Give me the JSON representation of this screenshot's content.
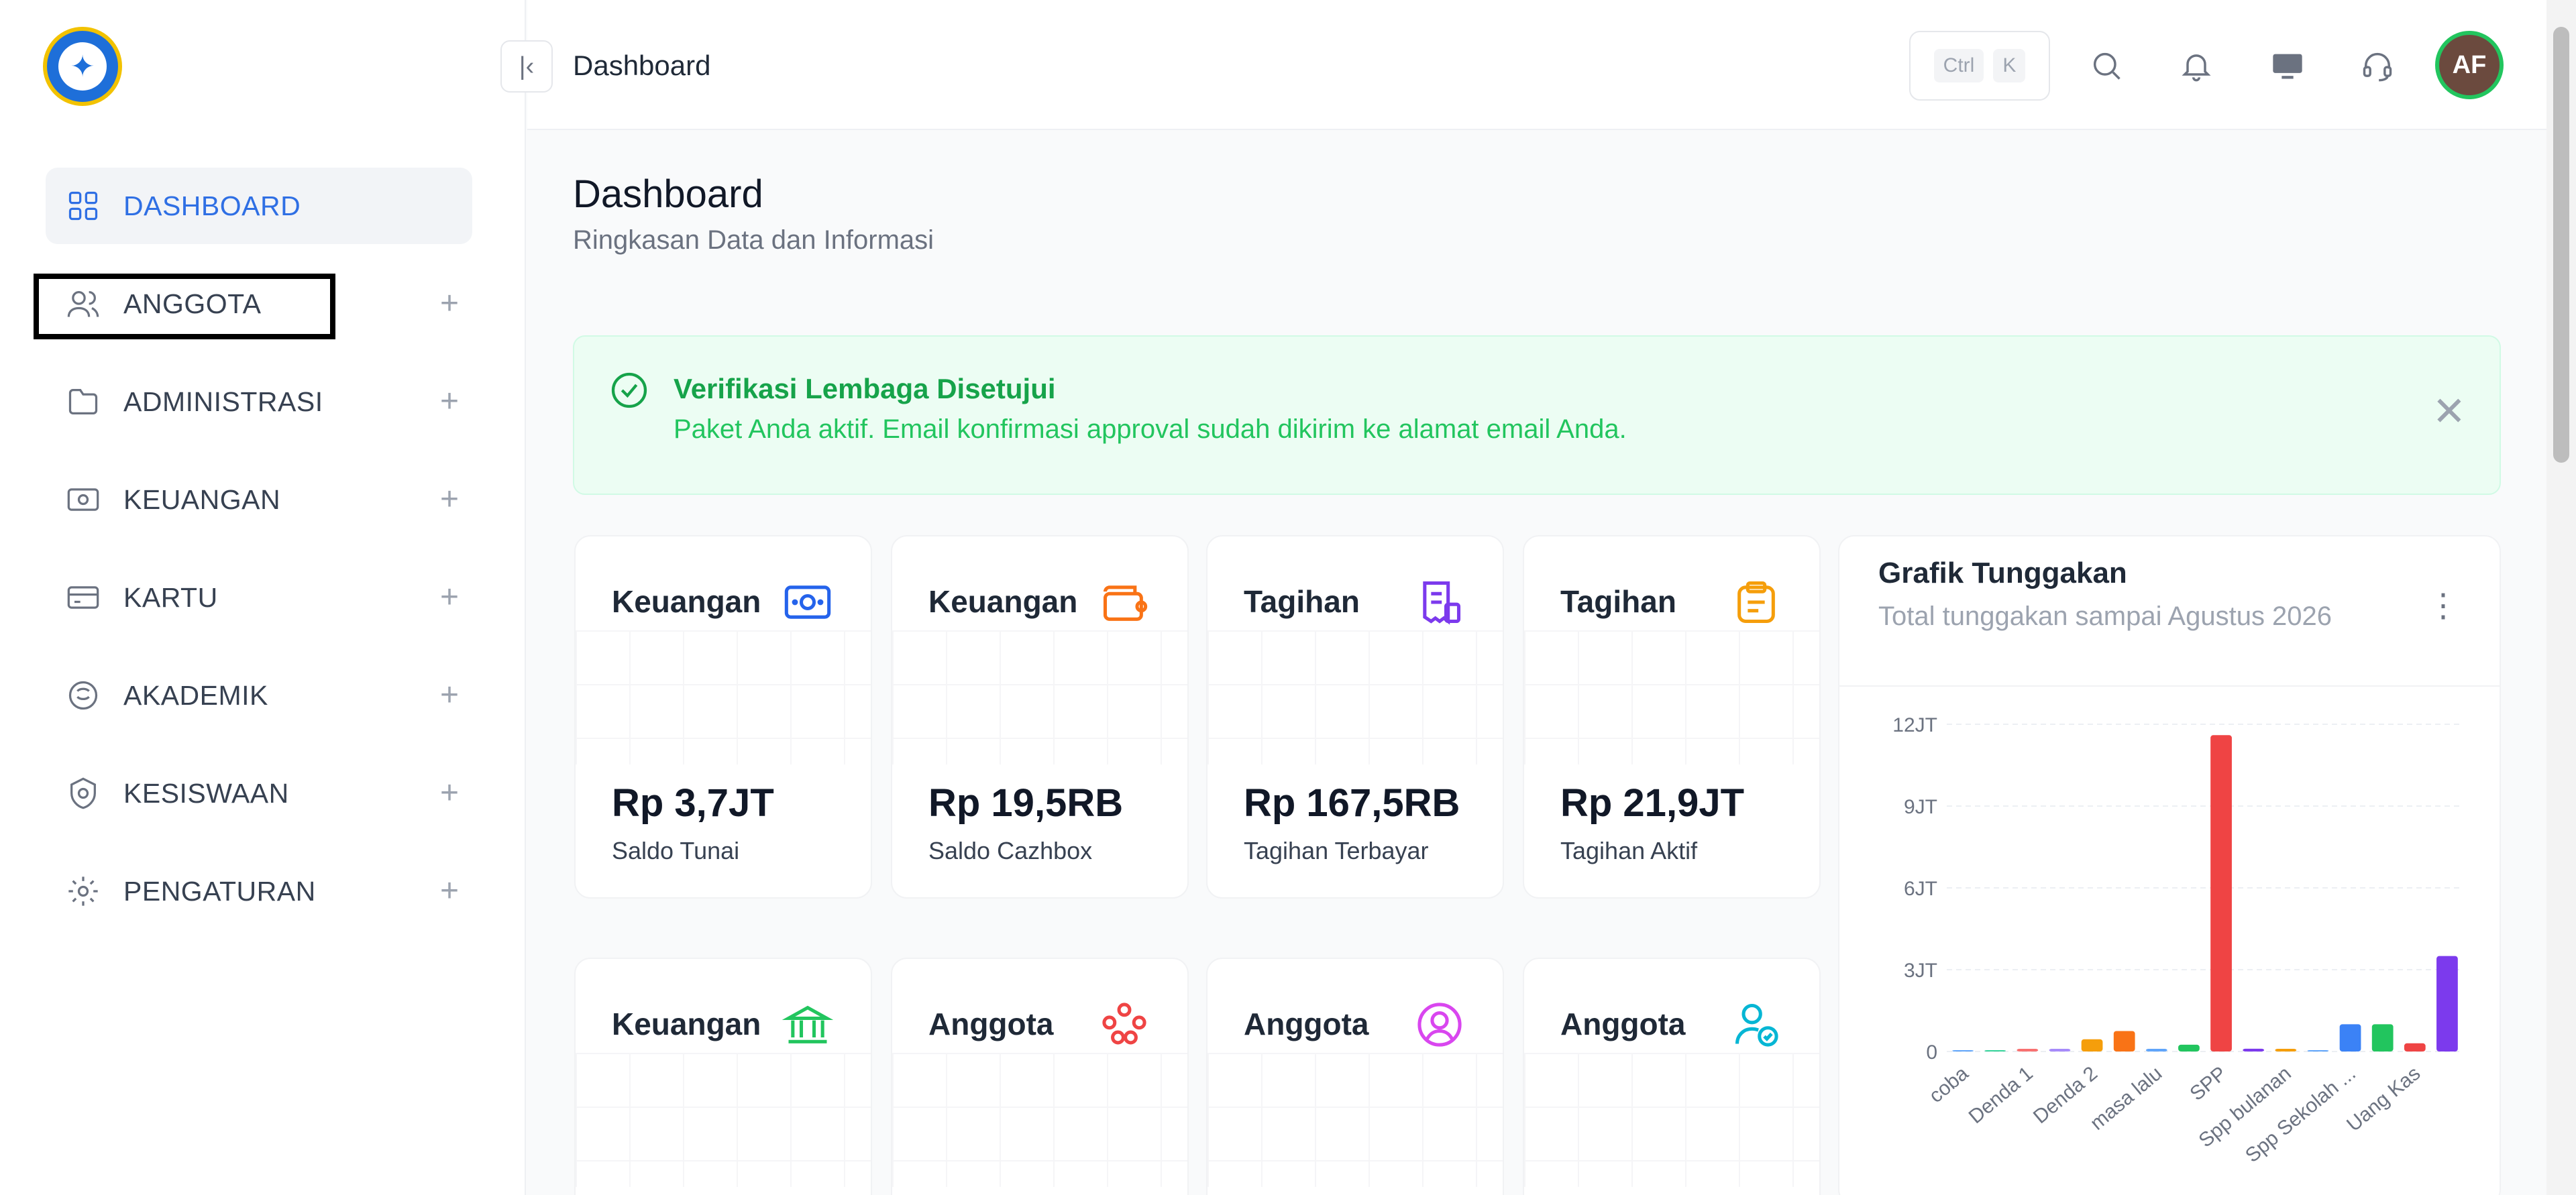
{
  "sidebar": {
    "items": [
      {
        "label": "DASHBOARD",
        "icon": "grid-icon",
        "active": true
      },
      {
        "label": "ANGGOTA",
        "icon": "users-icon"
      },
      {
        "label": "ADMINISTRASI",
        "icon": "folder-icon"
      },
      {
        "label": "KEUANGAN",
        "icon": "money-icon"
      },
      {
        "label": "KARTU",
        "icon": "card-icon"
      },
      {
        "label": "AKADEMIK",
        "icon": "academic-icon"
      },
      {
        "label": "KESISWAAN",
        "icon": "badge-icon"
      },
      {
        "label": "PENGATURAN",
        "icon": "gear-icon"
      }
    ]
  },
  "topbar": {
    "breadcrumb": "Dashboard",
    "kbd_ctrl": "Ctrl",
    "kbd_k": "K",
    "avatar": "AF"
  },
  "page": {
    "title": "Dashboard",
    "subtitle": "Ringkasan Data dan Informasi"
  },
  "alert": {
    "title": "Verifikasi Lembaga Disetujui",
    "text": "Paket Anda aktif. Email konfirmasi approval sudah dikirim ke alamat email Anda."
  },
  "cards": [
    {
      "title": "Keuangan",
      "value": "Rp 3,7JT",
      "label": "Saldo Tunai",
      "color": "#2563eb"
    },
    {
      "title": "Keuangan",
      "value": "Rp 19,5RB",
      "label": "Saldo Cazhbox",
      "color": "#f97316"
    },
    {
      "title": "Tagihan",
      "value": "Rp 167,5RB",
      "label": "Tagihan Terbayar",
      "color": "#7c3aed"
    },
    {
      "title": "Tagihan",
      "value": "Rp 21,9JT",
      "label": "Tagihan Aktif",
      "color": "#f59e0b"
    },
    {
      "title": "Keuangan",
      "color": "#22c55e"
    },
    {
      "title": "Anggota",
      "color": "#ef4444"
    },
    {
      "title": "Anggota",
      "color": "#d946ef"
    },
    {
      "title": "Anggota",
      "color": "#06b6d4"
    }
  ],
  "chart": {
    "title": "Grafik Tunggakan",
    "subtitle": "Total tunggakan sampai Agustus 2026"
  },
  "chart_data": {
    "type": "bar",
    "title": "Grafik Tunggakan",
    "subtitle": "Total tunggakan sampai Agustus 2026",
    "categories": [
      "coba",
      "",
      "Denda 1",
      "",
      "Denda 2",
      "",
      "masa lalu",
      "",
      "SPP",
      "",
      "Spp bulanan",
      "",
      "Spp Sekolah ...",
      "",
      "Uang Kas",
      ""
    ],
    "values": [
      0,
      0,
      0.05,
      0.05,
      0.45,
      0.75,
      0.05,
      0.25,
      11.6,
      0.1,
      0.05,
      0,
      1.0,
      1.0,
      0.3,
      3.5
    ],
    "colors": [
      "#60a5fa",
      "#34d399",
      "#f87171",
      "#a78bfa",
      "#f59e0b",
      "#f97316",
      "#60a5fa",
      "#22c55e",
      "#ef4444",
      "#7c3aed",
      "#f59e0b",
      "#60a5fa",
      "#3b82f6",
      "#22c55e",
      "#ef4444",
      "#7c3aed"
    ],
    "yticks": [
      "0",
      "3JT",
      "6JT",
      "9JT",
      "12JT"
    ],
    "ylim": [
      0,
      12
    ],
    "grid": true
  }
}
